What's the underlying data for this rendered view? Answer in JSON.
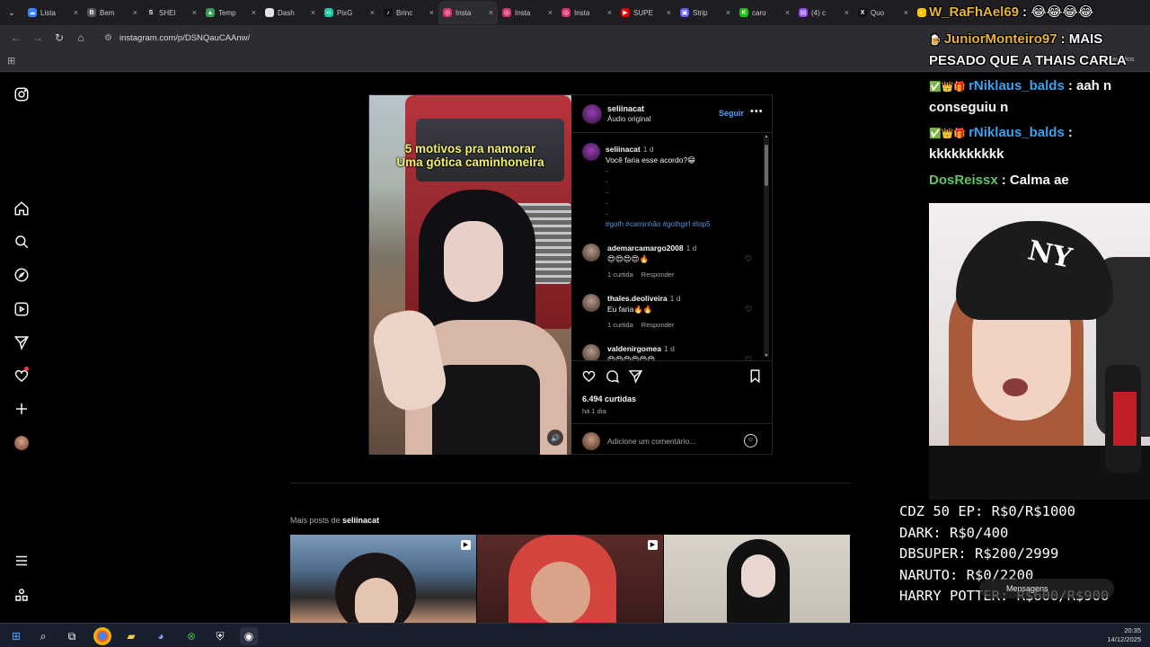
{
  "browser": {
    "tabs": [
      {
        "label": "Lista",
        "color": "#3a86ff",
        "glyph": "☁"
      },
      {
        "label": "Bem",
        "color": "#555",
        "glyph": "B"
      },
      {
        "label": "SHEI",
        "color": "#222",
        "glyph": "S"
      },
      {
        "label": "Temp",
        "color": "#3a9d5d",
        "glyph": "▲"
      },
      {
        "label": "Dash",
        "color": "#ddd",
        "glyph": "◯"
      },
      {
        "label": "PixG",
        "color": "#1ec8a5",
        "glyph": "‹›"
      },
      {
        "label": "Brinc",
        "color": "#111",
        "glyph": "♪"
      },
      {
        "label": "Insta",
        "color": "#d6306a",
        "glyph": "◎"
      },
      {
        "label": "Insta",
        "color": "#d6306a",
        "glyph": "◎"
      },
      {
        "label": "Insta",
        "color": "#d6306a",
        "glyph": "◎"
      },
      {
        "label": "SUPE",
        "color": "#e60000",
        "glyph": "▶"
      },
      {
        "label": "Strip",
        "color": "#635bff",
        "glyph": "▣"
      },
      {
        "label": "caro",
        "color": "#16c60c",
        "glyph": "K"
      },
      {
        "label": "(4) c",
        "color": "#9146ff",
        "glyph": "▤"
      },
      {
        "label": "Quo",
        "color": "#111",
        "glyph": "X"
      },
      {
        "label": "Pla",
        "color": "#f7c600",
        "glyph": "◐"
      }
    ],
    "active_tab_index": 7,
    "url": "instagram.com/p/DSNQauCAAnw/",
    "bookmarks_label": "avoritos"
  },
  "post": {
    "username": "seliinacat",
    "audio": "Áudio original",
    "follow_label": "Seguir",
    "more_label": "•••",
    "media_caption_line1": "5 motivos pra namorar",
    "media_caption_line2": "Uma gótica caminhoneira",
    "caption": {
      "user": "seliinacat",
      "time": "1 d",
      "text": "Você faria esse acordo?😁",
      "dots": ".\n.\n.\n.\n.",
      "hashtags": "#goth #caminhão #gothgirl #top5"
    },
    "comments": [
      {
        "user": "ademarcamargo2008",
        "time": "1 d",
        "text": "😍😍😍😍🔥",
        "likes": "1 curtida",
        "reply": "Responder"
      },
      {
        "user": "thales.deoliveira",
        "time": "1 d",
        "text": "Eu faria🔥🔥",
        "likes": "1 curtida",
        "reply": "Responder"
      },
      {
        "user": "valdenirgomea",
        "time": "1 d",
        "text": "😍😍😍😍😍😍",
        "likes": "",
        "reply": ""
      }
    ],
    "likes": "6.494 curtidas",
    "posted": "há 1 dia",
    "comment_placeholder": "Adicione um comentário..."
  },
  "more_posts": {
    "prefix": "Mais posts de",
    "user": "seliinacat"
  },
  "chat": [
    {
      "name": "W_RaFhAel69",
      "text": ": 😂😂😂😂",
      "name_color": "gold",
      "badges": ""
    },
    {
      "name": "JuniorMonteiro97",
      "text": ": MAIS",
      "name_color": "gold",
      "badges": "🍺"
    },
    {
      "name": "",
      "text": "PESADO QUE A THAIS CARLA",
      "name_color": "white",
      "badges": ""
    },
    {
      "name": "rNiklaus_balds",
      "text": ": aah n",
      "name_color": "blue",
      "badges": "✅👑🎁"
    },
    {
      "name": "",
      "text": "conseguiu n",
      "name_color": "white",
      "badges": ""
    },
    {
      "name": "rNiklaus_balds",
      "text": ":",
      "name_color": "blue",
      "badges": "✅👑🎁"
    },
    {
      "name": "",
      "text": "kkkkkkkkkk",
      "name_color": "white",
      "badges": ""
    },
    {
      "name": "DosReissx",
      "text": ": Calma ae",
      "name_color": "green",
      "badges": ""
    }
  ],
  "goals": [
    "CDZ 50 EP: R$0/R$1000",
    "DARK: R$0/400",
    "DBSUPER: R$200/2999",
    "NARUTO: R$0/2200",
    "HARRY POTTER: R$600/R$900"
  ],
  "messages_label": "Mensagens",
  "taskbar": {
    "time": "20:35",
    "date": "14/12/2025"
  },
  "colors": {
    "follow_blue": "#4a9ff5",
    "hashtag_blue": "#5f8fd8",
    "notification_red": "#ff3040"
  }
}
